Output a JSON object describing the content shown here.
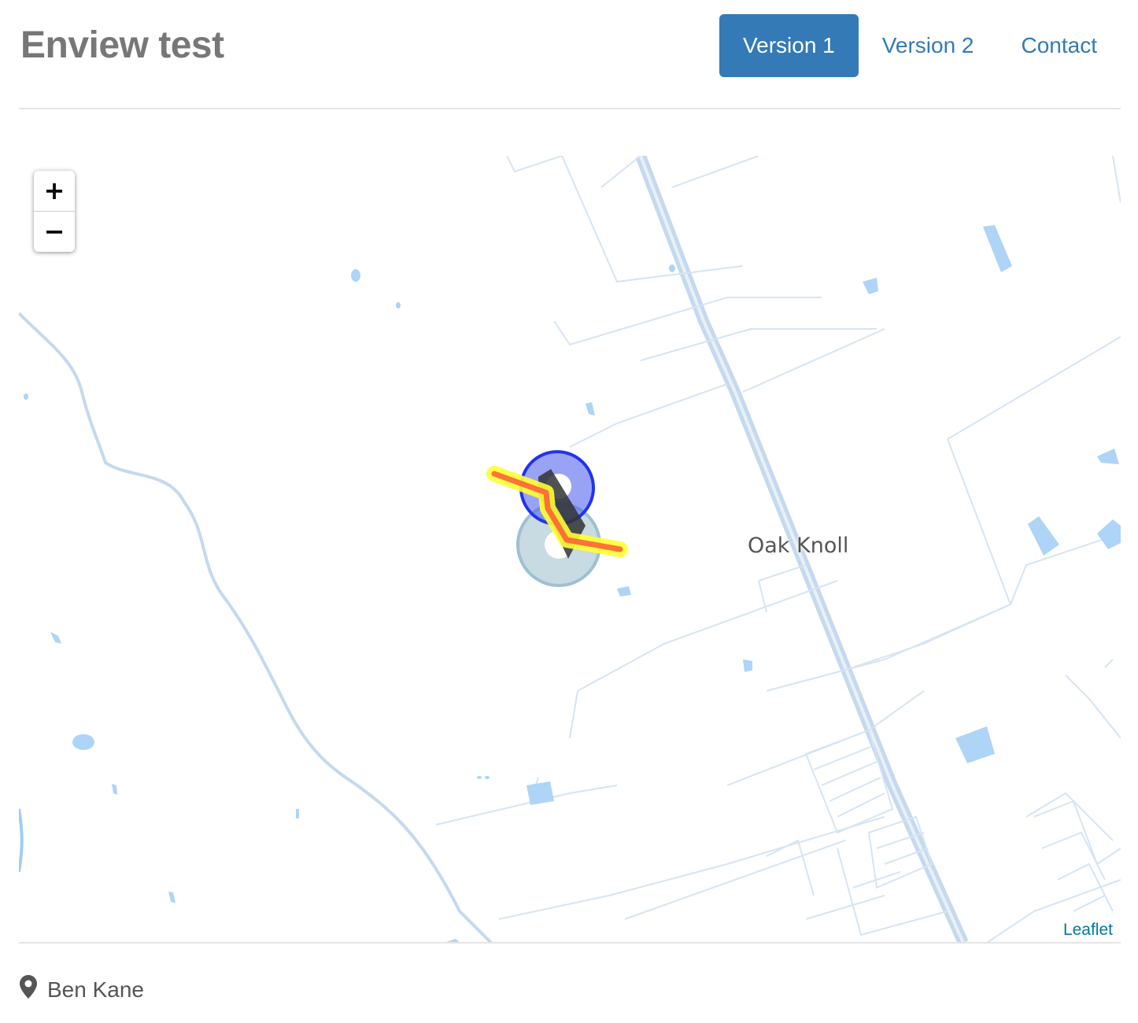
{
  "header": {
    "title": "Enview test",
    "nav": [
      {
        "label": "Version 1",
        "active": true
      },
      {
        "label": "Version 2",
        "active": false
      },
      {
        "label": "Contact",
        "active": false
      }
    ]
  },
  "map": {
    "zoom_in_label": "+",
    "zoom_out_label": "−",
    "place_label": "Oak Knoll",
    "attribution": "Leaflet",
    "colors": {
      "water": "#9fcdf5",
      "roads": "#c5d9ee",
      "railway": "#bcd2ea",
      "circle_blue": "#2233ee",
      "circle_grey": "#9fc0d0",
      "route_outer": "#ffff00",
      "route_inner": "#ff6633"
    }
  },
  "footer": {
    "icon": "map-marker-icon",
    "author": "Ben Kane"
  }
}
